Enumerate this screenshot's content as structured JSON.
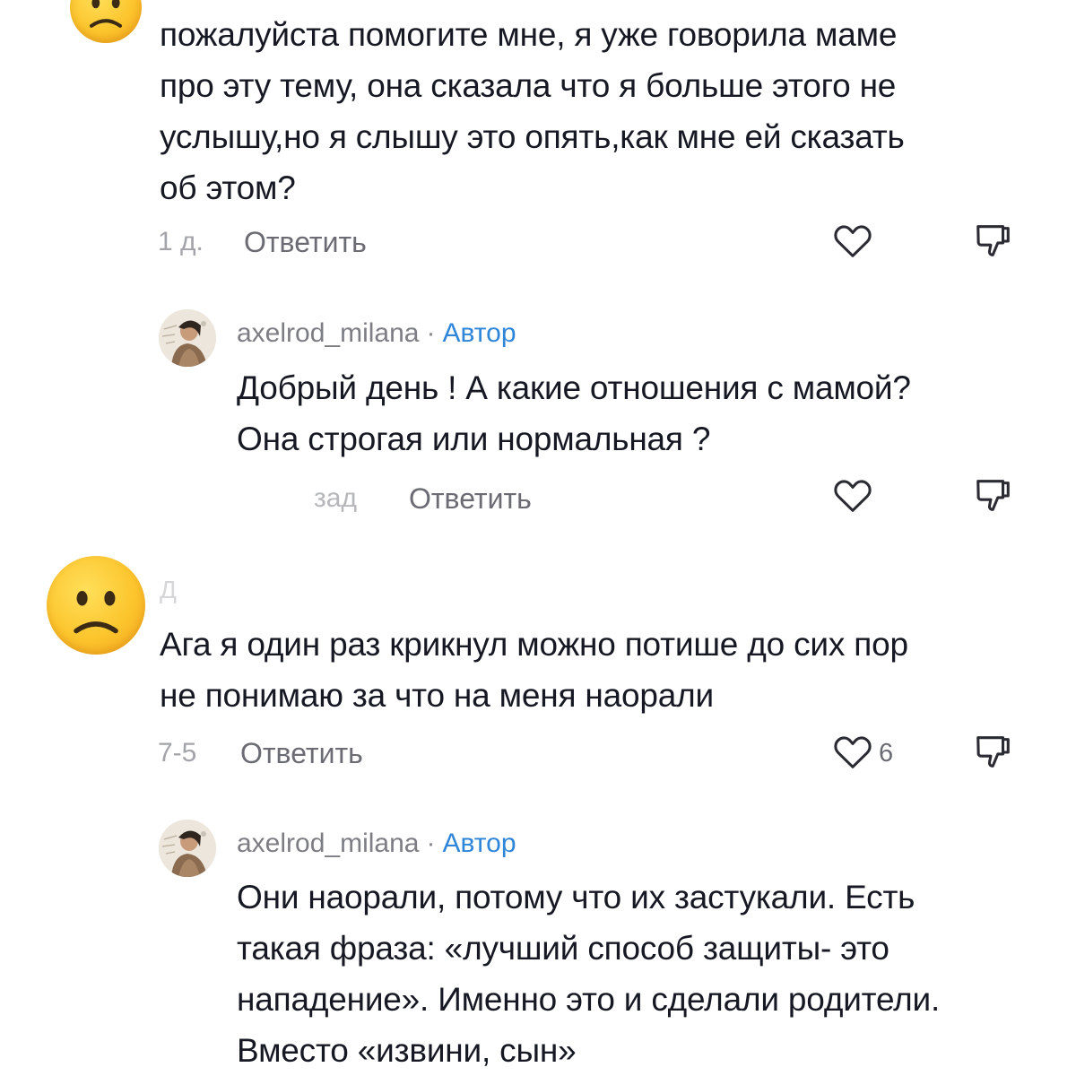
{
  "thread": {
    "comments": [
      {
        "avatar_icon": "sad-face-emoji-icon",
        "text": "пожалуйста помогите мне, я уже говорила маме\nпро эту тему, она сказала что я больше этого не\nуслышу,но я слышу это опять,как мне ей сказать\nоб этом?",
        "time": "1 д.",
        "reply_label": "Ответить",
        "like_icon": "heart-outline-icon",
        "dislike_icon": "thumbs-down-outline-icon",
        "reply": {
          "avatar_icon": "profile-photo-avatar",
          "username": "axelrod_milana",
          "separator": "·",
          "author_badge": "Автор",
          "text": "Добрый день ! А какие отношения с мамой?\nОна строгая или нормальная ?",
          "time": "зад",
          "reply_label": "Ответить"
        }
      },
      {
        "avatar_icon": "sad-face-emoji-icon",
        "username_partial": "Д",
        "text": "Ага я один раз крикнул можно потише до сих пор\nне понимаю за что на меня наорали",
        "time": "7-5",
        "reply_label": "Ответить",
        "likes": "6",
        "like_icon": "heart-outline-icon",
        "dislike_icon": "thumbs-down-outline-icon",
        "reply": {
          "avatar_icon": "profile-photo-avatar",
          "username": "axelrod_milana",
          "separator": "·",
          "author_badge": "Автор",
          "text": "Они наорали, потому что их застукали. Есть\nтакая фраза: «лучший способ защиты- это\nнападение». Именно это и сделали родители.\nВместо «извини, сын»"
        }
      }
    ]
  },
  "colors": {
    "text": "#161823",
    "secondary": "#7d7e84",
    "author_badge": "#2f86d9",
    "icon_stroke": "#2a2b33"
  }
}
